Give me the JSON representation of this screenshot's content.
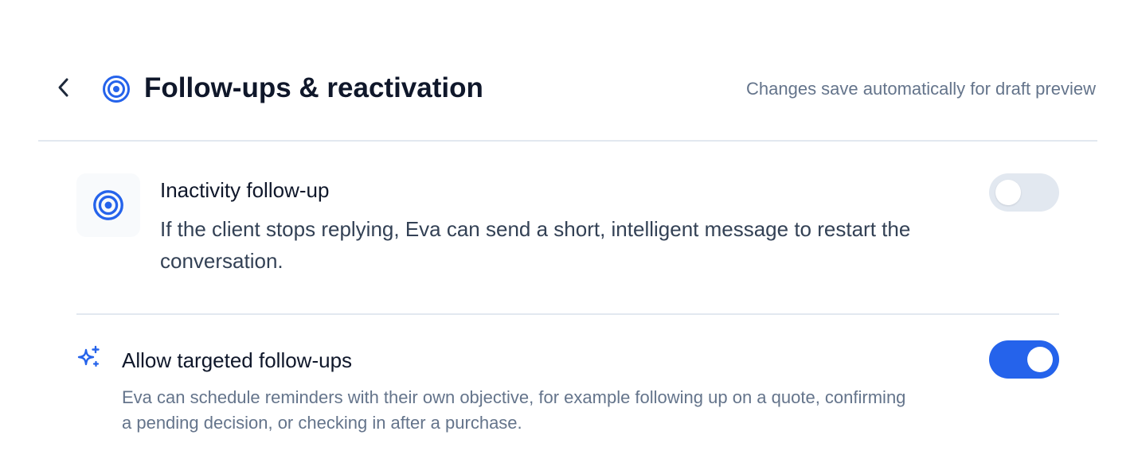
{
  "header": {
    "back_icon": "chevron-left-icon",
    "title_icon": "target-icon",
    "title": "Follow-ups & reactivation",
    "autosave_note": "Changes save automatically for draft preview"
  },
  "settings": [
    {
      "icon": "target-icon",
      "title": "Inactivity follow-up",
      "description": "If the client stops replying, Eva can send a short, intelligent message to restart the conversation.",
      "enabled": false
    },
    {
      "icon": "sparkle-icon",
      "title": "Allow targeted follow-ups",
      "description": "Eva can schedule reminders with their own objective, for example following up on a quote, confirming a pending decision, or checking in after a purchase.",
      "enabled": true
    }
  ],
  "colors": {
    "accent": "#2563eb",
    "toggle_off": "#e2e8f0",
    "divider": "#e2e8f0",
    "muted_text": "#64748b"
  }
}
